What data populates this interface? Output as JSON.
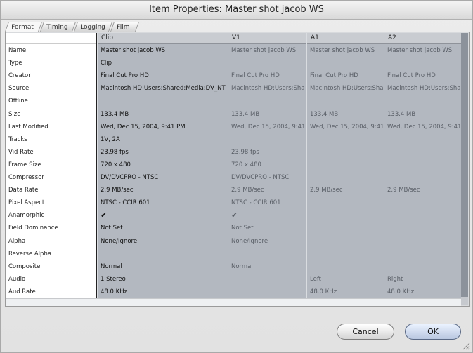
{
  "window": {
    "title": "Item Properties: Master shot jacob WS"
  },
  "tabs": [
    {
      "label": "Format"
    },
    {
      "label": "Timing"
    },
    {
      "label": "Logging"
    },
    {
      "label": "Film"
    }
  ],
  "table": {
    "columns": [
      "",
      "Clip",
      "V1",
      "A1",
      "A2"
    ],
    "rows": [
      {
        "label": "Name",
        "clip": "Master shot jacob WS",
        "v1": "Master shot jacob WS",
        "a1": "Master shot jacob WS",
        "a2": "Master shot jacob WS"
      },
      {
        "label": "Type",
        "clip": "Clip",
        "v1": "",
        "a1": "",
        "a2": ""
      },
      {
        "label": "Creator",
        "clip": "Final Cut Pro HD",
        "v1": "Final Cut Pro HD",
        "a1": "Final Cut Pro HD",
        "a2": "Final Cut Pro HD"
      },
      {
        "label": "Source",
        "clip": "Macintosh HD:Users:Shared:Media:DV_NT",
        "v1": "Macintosh HD:Users:Sha",
        "a1": "Macintosh HD:Users:Sha",
        "a2": "Macintosh HD:Users:Sha"
      },
      {
        "label": "Offline",
        "clip": "",
        "v1": "",
        "a1": "",
        "a2": ""
      },
      {
        "label": "Size",
        "clip": "133.4 MB",
        "v1": "133.4 MB",
        "a1": "133.4 MB",
        "a2": "133.4 MB"
      },
      {
        "label": "Last Modified",
        "clip": "Wed, Dec 15, 2004, 9:41 PM",
        "v1": "Wed, Dec 15, 2004, 9:41",
        "a1": "Wed, Dec 15, 2004, 9:41",
        "a2": "Wed, Dec 15, 2004, 9:41"
      },
      {
        "label": "Tracks",
        "clip": "1V, 2A",
        "v1": "",
        "a1": "",
        "a2": ""
      },
      {
        "label": "Vid Rate",
        "clip": "23.98 fps",
        "v1": "23.98 fps",
        "a1": "",
        "a2": ""
      },
      {
        "label": "Frame Size",
        "clip": "720 x 480",
        "v1": "720 x 480",
        "a1": "",
        "a2": ""
      },
      {
        "label": "Compressor",
        "clip": "DV/DVCPRO - NTSC",
        "v1": "DV/DVCPRO - NTSC",
        "a1": "",
        "a2": ""
      },
      {
        "label": "Data Rate",
        "clip": "2.9 MB/sec",
        "v1": "2.9 MB/sec",
        "a1": "2.9 MB/sec",
        "a2": "2.9 MB/sec"
      },
      {
        "label": "Pixel Aspect",
        "clip": "NTSC - CCIR 601",
        "v1": "NTSC - CCIR 601",
        "a1": "",
        "a2": ""
      },
      {
        "label": "Anamorphic",
        "clip": "✔",
        "v1": "✔",
        "a1": "",
        "a2": ""
      },
      {
        "label": "Field Dominance",
        "clip": "Not Set",
        "v1": "Not Set",
        "a1": "",
        "a2": ""
      },
      {
        "label": "Alpha",
        "clip": "None/Ignore",
        "v1": "None/Ignore",
        "a1": "",
        "a2": ""
      },
      {
        "label": "Reverse Alpha",
        "clip": "",
        "v1": "",
        "a1": "",
        "a2": ""
      },
      {
        "label": "Composite",
        "clip": "Normal",
        "v1": "Normal",
        "a1": "",
        "a2": ""
      },
      {
        "label": "Audio",
        "clip": "1 Stereo",
        "v1": "",
        "a1": "Left",
        "a2": "Right"
      },
      {
        "label": "Aud Rate",
        "clip": "48.0 KHz",
        "v1": "",
        "a1": "48.0 KHz",
        "a2": "48.0 KHz"
      }
    ]
  },
  "buttons": {
    "cancel": "Cancel",
    "ok": "OK"
  },
  "colors": {
    "data_bg": "#b3b8c0",
    "label_bg": "#ffffff",
    "window_bg": "#e6e6e6"
  }
}
